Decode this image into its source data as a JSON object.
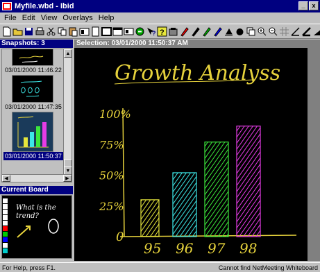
{
  "window": {
    "title": "Myfile.wbd - Ibid"
  },
  "title_buttons": [
    "_",
    "x"
  ],
  "menu": [
    {
      "label": "File",
      "key": "F"
    },
    {
      "label": "Edit",
      "key": "E"
    },
    {
      "label": "View",
      "key": "V"
    },
    {
      "label": "Overlays",
      "key": "O"
    },
    {
      "label": "Help",
      "key": "H"
    }
  ],
  "toolbar_icons": [
    "new-icon",
    "open-icon",
    "save-icon",
    "print-icon",
    "cut-icon",
    "copy-icon",
    "paste-icon",
    "slide-icon",
    "page-icon",
    "frame-icon",
    "window-icon",
    "board-icon",
    "green-dot-icon",
    "help-arrow-icon",
    "help-icon",
    "clear-board-icon",
    "pen-red-icon",
    "pen-black-icon",
    "pen-green-icon",
    "pen-blue-icon",
    "eraser-icon",
    "fill-icon",
    "layers-icon",
    "zoom-in-icon",
    "zoom-out-icon",
    "grid-icon",
    "line-icon",
    "line-thick-icon",
    "slant-icon"
  ],
  "snapshots": {
    "header": "Snapshots: 3",
    "items": [
      {
        "caption": "03/01/2000 11:46.22 AM"
      },
      {
        "caption": "03/01/2000 11:47:35 AM"
      },
      {
        "caption": "03/01/2000 11:50:37 AM",
        "selected": true
      }
    ]
  },
  "current_board": {
    "header": "Current Board",
    "palette": [
      "#ffffff",
      "#ffffff",
      "#ffffff",
      "#ffffff",
      "#ffffff",
      "#ff0000",
      "#00cc00",
      "#0000ff",
      "#ffffff",
      "#00cccc"
    ],
    "text": "What is the trend?"
  },
  "selection": {
    "header": "Selection: 03/01/2000 11:50:37 AM"
  },
  "whiteboard": {
    "title": "Growth Analyss",
    "y_labels": [
      "100%",
      "75%",
      "50%",
      "25%",
      "0"
    ],
    "x_labels": [
      "95",
      "96",
      "97",
      "98"
    ],
    "bar_colors": [
      "#e6e63c",
      "#3ce6e6",
      "#3ce63c",
      "#e63ce6"
    ],
    "title_color": "#e6d23c",
    "axis_color": "#e6d23c"
  },
  "chart_data": {
    "type": "bar",
    "title": "Growth Analyss",
    "categories": [
      "95",
      "96",
      "97",
      "98"
    ],
    "values": [
      30,
      52,
      77,
      90
    ],
    "ylim": [
      0,
      100
    ],
    "y_ticks": [
      "0",
      "25%",
      "50%",
      "75%",
      "100%"
    ]
  },
  "status": {
    "left": "For Help, press F1.",
    "right": "Cannot find NetMeeting Whiteboard"
  }
}
